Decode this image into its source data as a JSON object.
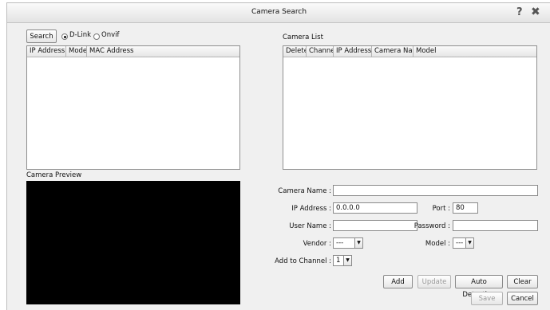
{
  "window": {
    "title": "Camera Search",
    "help_icon": "question-icon",
    "close_icon": "close-icon"
  },
  "search": {
    "button_label": "Search",
    "options": [
      {
        "label": "D-Link",
        "selected": true
      },
      {
        "label": "Onvif",
        "selected": false
      }
    ]
  },
  "results_table": {
    "columns": [
      "IP Address",
      "Model",
      "MAC Address"
    ],
    "rows": []
  },
  "camera_list": {
    "heading": "Camera List",
    "columns": [
      "Delete",
      "Channel",
      "IP Address",
      "Camera Name",
      "Model"
    ],
    "rows": []
  },
  "preview": {
    "heading": "Camera Preview"
  },
  "form": {
    "camera_name": {
      "label": "Camera Name :",
      "value": ""
    },
    "ip_address": {
      "label": "IP Address :",
      "value": "0.0.0.0"
    },
    "port": {
      "label": "Port :",
      "value": "80"
    },
    "user_name": {
      "label": "User Name :",
      "value": ""
    },
    "password": {
      "label": "Password :",
      "value": ""
    },
    "vendor": {
      "label": "Vendor :",
      "value": "---"
    },
    "model": {
      "label": "Model :",
      "value": "---"
    },
    "channel": {
      "label": "Add to Channel :",
      "value": "1"
    }
  },
  "buttons": {
    "add": "Add",
    "update": "Update",
    "auto_detection": "Auto Detection",
    "clear": "Clear",
    "save": "Save",
    "cancel": "Cancel"
  }
}
